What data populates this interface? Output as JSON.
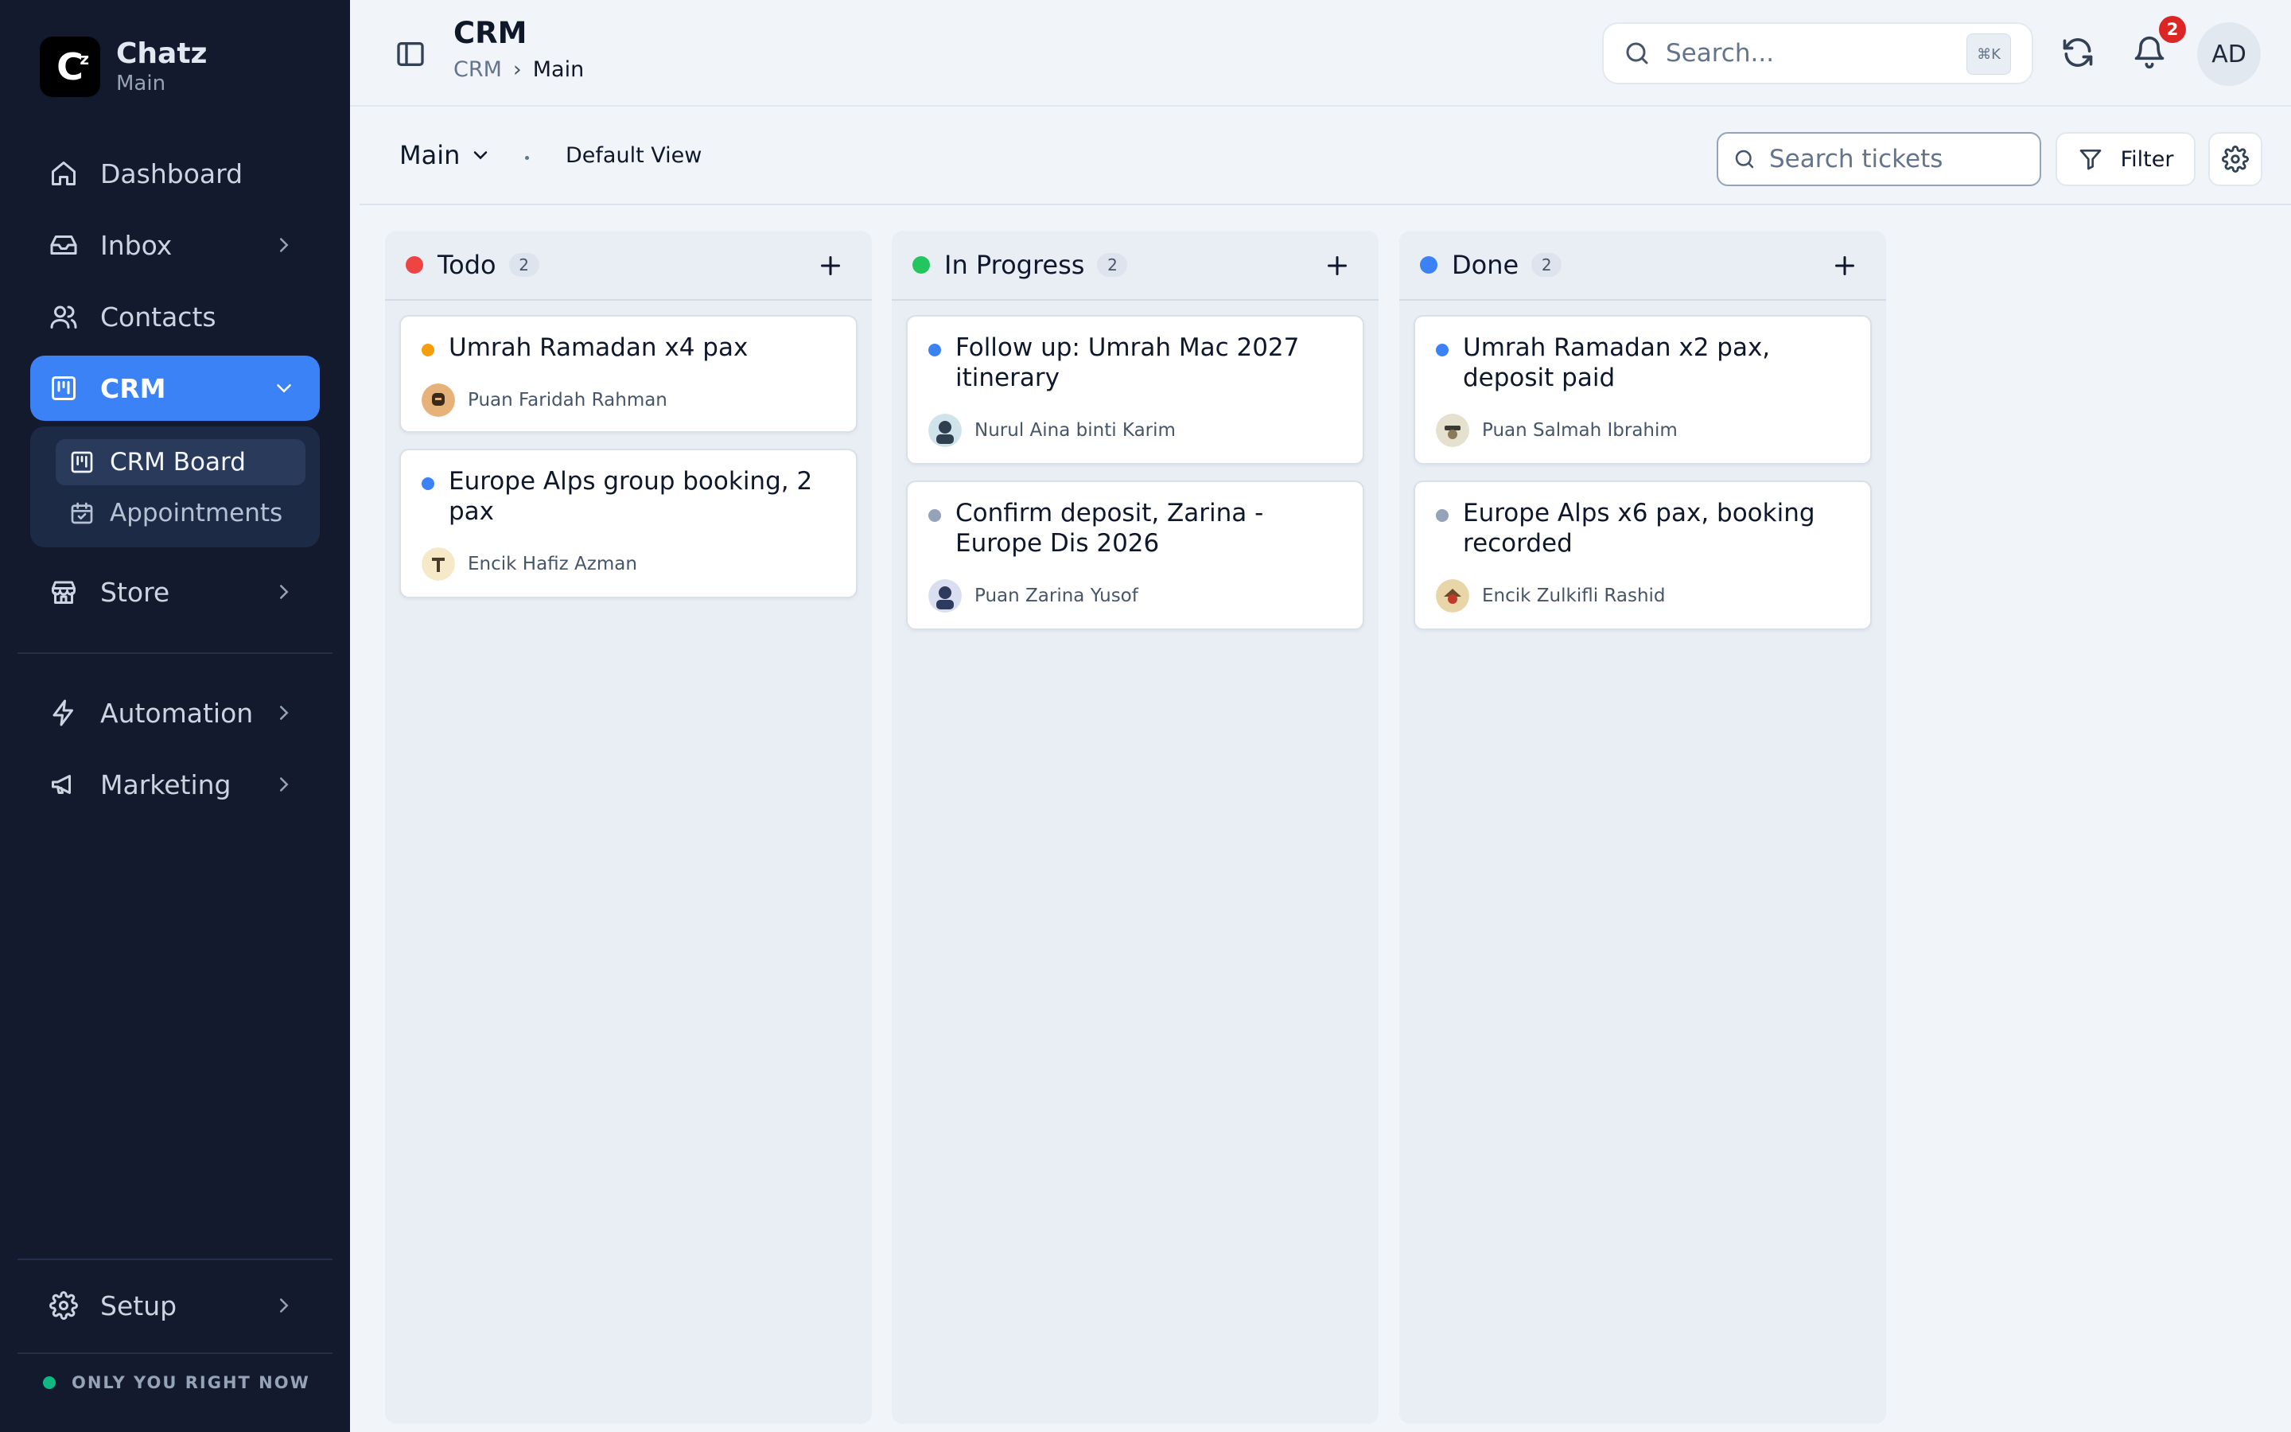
{
  "brand": {
    "name": "Chatz",
    "workspace": "Main",
    "logo_text": "C"
  },
  "sidebar": {
    "items": [
      {
        "label": "Dashboard",
        "icon": "home-icon"
      },
      {
        "label": "Inbox",
        "icon": "inbox-icon"
      },
      {
        "label": "Contacts",
        "icon": "users-icon"
      },
      {
        "label": "CRM",
        "icon": "kanban-icon"
      },
      {
        "label": "Store",
        "icon": "store-icon"
      },
      {
        "label": "Automation",
        "icon": "bolt-icon"
      },
      {
        "label": "Marketing",
        "icon": "megaphone-icon"
      },
      {
        "label": "Setup",
        "icon": "gear-icon"
      }
    ],
    "crm_sub": [
      {
        "label": "CRM Board",
        "icon": "kanban-icon"
      },
      {
        "label": "Appointments",
        "icon": "calendar-icon"
      }
    ],
    "status": "ONLY YOU RIGHT NOW"
  },
  "header": {
    "title": "CRM",
    "breadcrumb": [
      "CRM",
      "Main"
    ],
    "search_placeholder": "Search...",
    "search_shortcut": "⌘K",
    "notification_count": "2",
    "avatar_initials": "AD"
  },
  "toolbar": {
    "pipeline": "Main",
    "view": "Default View",
    "ticket_search_placeholder": "Search tickets",
    "filter_label": "Filter"
  },
  "columns": [
    {
      "title": "Todo",
      "count": "2",
      "color": "#ef4444",
      "cards": [
        {
          "title": "Umrah Ramadan x4 pax",
          "person": "Puan Faridah Rahman",
          "dot": "#f59e0b"
        },
        {
          "title": "Europe Alps group booking, 2 pax",
          "person": "Encik Hafiz Azman",
          "dot": "#3b82f6"
        }
      ]
    },
    {
      "title": "In Progress",
      "count": "2",
      "color": "#22c55e",
      "cards": [
        {
          "title": "Follow up: Umrah Mac 2027 itinerary",
          "person": "Nurul Aina binti Karim",
          "dot": "#3b82f6"
        },
        {
          "title": "Confirm deposit, Zarina - Europe Dis 2026",
          "person": "Puan Zarina Yusof",
          "dot": "#94a3b8"
        }
      ]
    },
    {
      "title": "Done",
      "count": "2",
      "color": "#3b82f6",
      "cards": [
        {
          "title": "Umrah Ramadan x2 pax, deposit paid",
          "person": "Puan Salmah Ibrahim",
          "dot": "#3b82f6"
        },
        {
          "title": "Europe Alps x6 pax, booking recorded",
          "person": "Encik Zulkifli Rashid",
          "dot": "#94a3b8"
        }
      ]
    }
  ]
}
